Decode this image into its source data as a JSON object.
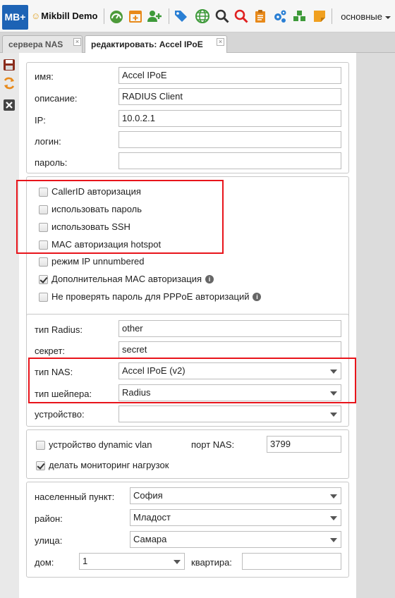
{
  "app": {
    "logo": "MB+",
    "demo_label": "Mikbill Demo",
    "menu_label": "основные"
  },
  "toolbar_icons": [
    "dashboard-icon",
    "calendar-add-icon",
    "add-user-icon",
    "tags-icon",
    "globe-icon",
    "search-icon",
    "search-red-icon",
    "clipboard-icon",
    "settings-cogs-icon",
    "cubes-icon",
    "sticky-note-icon"
  ],
  "tabs": [
    {
      "label": "сервера NAS",
      "active": false
    },
    {
      "label": "редактировать: Accel IPoE",
      "active": true
    }
  ],
  "side_icons": [
    "save-icon",
    "refresh-icon",
    "close-icon"
  ],
  "general": {
    "name_label": "имя:",
    "name_value": "Accel IPoE",
    "desc_label": "описание:",
    "desc_value": "RADIUS Client",
    "ip_label": "IP:",
    "ip_value": "10.0.2.1",
    "login_label": "логин:",
    "login_value": "",
    "password_label": "пароль:",
    "password_value": ""
  },
  "options": [
    {
      "label": "CallerID авторизация",
      "checked": false
    },
    {
      "label": "использовать пароль",
      "checked": false
    },
    {
      "label": "использовать SSH",
      "checked": false
    },
    {
      "label": "MAC авторизация hotspot",
      "checked": false
    },
    {
      "label": "режим IP unnumbered",
      "checked": false
    },
    {
      "label": "Дополнительная MAC авторизация",
      "checked": true
    },
    {
      "label": "Не проверять пароль для PPPoE авторизаций",
      "checked": false
    }
  ],
  "radius": {
    "type_label": "тип Radius:",
    "type_value": "other",
    "secret_label": "секрет:",
    "secret_value": "secret",
    "nas_type_label": "тип NAS:",
    "nas_type_value": "Accel IPoE (v2)",
    "shaper_label": "тип шейпера:",
    "shaper_value": "Radius",
    "device_label": "устройство:",
    "device_value": ""
  },
  "vlan": {
    "dynamic_vlan_label": "устройство dynamic vlan",
    "dynamic_vlan_checked": false,
    "nas_port_label": "порт NAS:",
    "nas_port_value": "3799",
    "monitoring_label": "делать мониторинг нагрузок",
    "monitoring_checked": true
  },
  "address": {
    "city_label": "населенный пункт:",
    "city_value": "София",
    "district_label": "район:",
    "district_value": "Младост",
    "street_label": "улица:",
    "street_value": "Самара",
    "house_label": "дом:",
    "house_value": "1",
    "apartment_label": "квартира:",
    "apartment_value": ""
  },
  "colors": {
    "highlight": "#e8141b",
    "brand": "#1d63b5"
  }
}
